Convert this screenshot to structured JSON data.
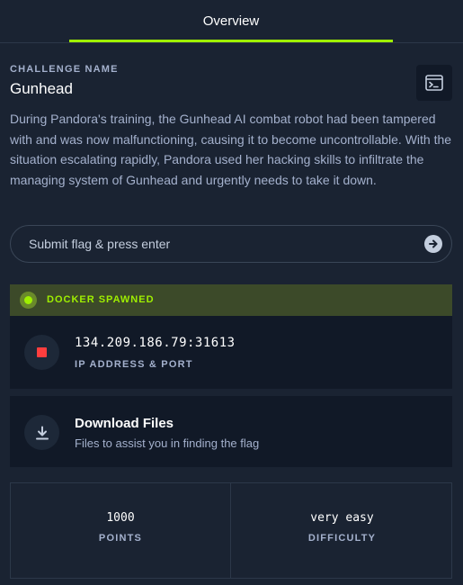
{
  "tabs": [
    {
      "label": "Overview",
      "active": true
    }
  ],
  "challenge": {
    "label": "CHALLENGE NAME",
    "name": "Gunhead",
    "description": "During Pandora's training, the Gunhead AI combat robot had been tampered with and was now malfunctioning, causing it to become uncontrollable. With the situation escalating rapidly, Pandora used her hacking skills to infiltrate the managing system of Gunhead and urgently needs to take it down."
  },
  "flag_input": {
    "placeholder": "Submit flag & press enter",
    "value": ""
  },
  "docker": {
    "status": "DOCKER SPAWNED",
    "status_color": "#9fef00"
  },
  "instance": {
    "address": "134.209.186.79:31613",
    "label": "IP ADDRESS & PORT",
    "stop_color": "#ff3e3e"
  },
  "download": {
    "title": "Download Files",
    "subtitle": "Files to assist you in finding the flag"
  },
  "stats": {
    "points": {
      "value": "1000",
      "label": "POINTS"
    },
    "difficulty": {
      "value": "very easy",
      "label": "DIFFICULTY"
    }
  },
  "colors": {
    "accent": "#9fef00",
    "background": "#1a2332",
    "card": "#111927"
  },
  "icons": [
    "terminal-icon",
    "arrow-right-icon",
    "stop-icon",
    "download-icon"
  ]
}
